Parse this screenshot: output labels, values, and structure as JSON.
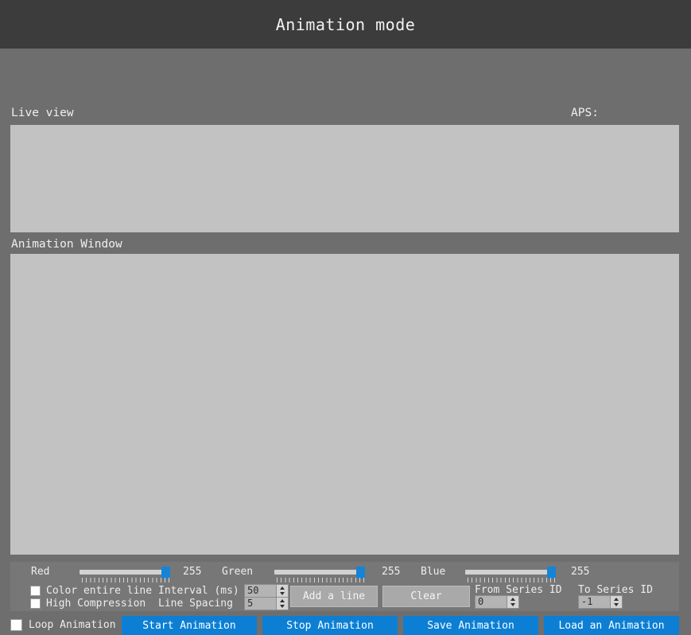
{
  "window": {
    "title": "Animation mode"
  },
  "sections": {
    "live_view_label": "Live view",
    "aps_label": "APS:",
    "animation_window_label": "Animation Window"
  },
  "colors": {
    "accent_blue": "#0c7fd4",
    "slider_handle": "#1584d8",
    "titlebar_bg": "#3c3c3c",
    "window_bg": "#6e6e6e",
    "panel_bg": "#c2c2c2",
    "group_bg": "#777777"
  },
  "color_sliders": [
    {
      "label": "Red",
      "value": "255",
      "min": 0,
      "max": 255,
      "percent": 100
    },
    {
      "label": "Green",
      "value": "255",
      "min": 0,
      "max": 255,
      "percent": 100
    },
    {
      "label": "Blue",
      "value": "255",
      "min": 0,
      "max": 255,
      "percent": 100
    }
  ],
  "checkboxes": [
    {
      "name": "color-entire-line",
      "label": "Color entire line",
      "checked": false
    },
    {
      "name": "high-compression",
      "label": "High Compression",
      "checked": false
    },
    {
      "name": "loop-animation",
      "label": "Loop Animation",
      "checked": false
    }
  ],
  "spinboxes": [
    {
      "name": "interval",
      "label": "Interval (ms)",
      "value": "50"
    },
    {
      "name": "line-spacing",
      "label": "Line Spacing",
      "value": "5"
    },
    {
      "name": "from-series-id",
      "label": "From Series ID",
      "value": "0"
    },
    {
      "name": "to-series-id",
      "label": "To Series ID",
      "value": "-1"
    }
  ],
  "gray_buttons": [
    {
      "name": "add-a-line",
      "label": "Add a line"
    },
    {
      "name": "clear",
      "label": "Clear"
    }
  ],
  "blue_buttons": [
    {
      "name": "start-animation",
      "label": "Start Animation"
    },
    {
      "name": "stop-animation",
      "label": "Stop Animation"
    },
    {
      "name": "save-animation",
      "label": "Save Animation"
    },
    {
      "name": "load-an-animation",
      "label": "Load an Animation"
    }
  ]
}
